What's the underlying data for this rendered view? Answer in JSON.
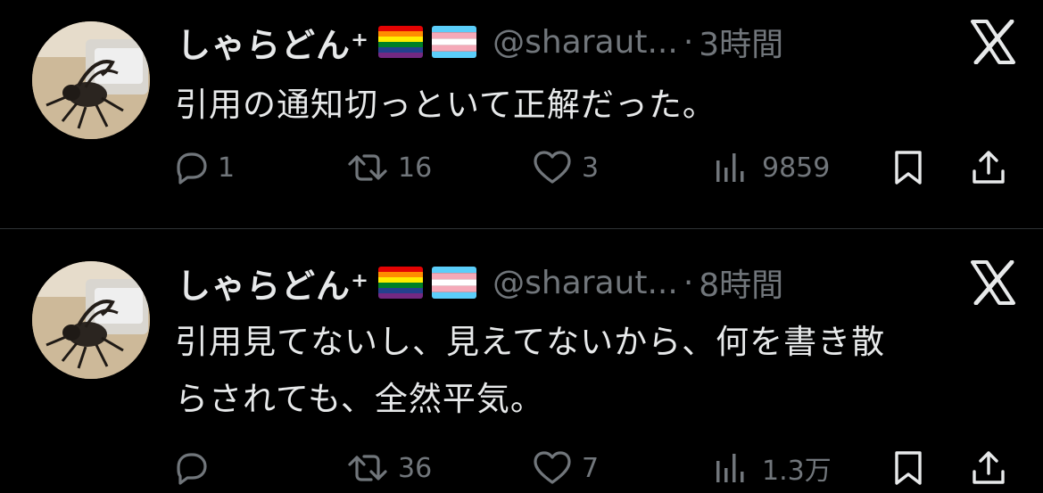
{
  "tweets": [
    {
      "display_name": "しゃらどん⁺",
      "handle": "@sharaut...",
      "separator": "·",
      "time": "3時間",
      "text_lines": [
        "引用の通知切っといて正解だった。"
      ],
      "actions": {
        "reply_count": "1",
        "retweet_count": "16",
        "like_count": "3",
        "views_count": "9859"
      }
    },
    {
      "display_name": "しゃらどん⁺",
      "handle": "@sharaut...",
      "separator": "·",
      "time": "8時間",
      "text_lines": [
        "引用見てないし、見えてないから、何を書き散",
        "らされても、全然平気。"
      ],
      "actions": {
        "reply_count": "",
        "retweet_count": "36",
        "like_count": "7",
        "views_count": "1.3万"
      }
    }
  ],
  "colors": {
    "background": "#000000",
    "primary_text": "#e7e9ea",
    "secondary_text": "#71767b",
    "divider": "#2f3336"
  },
  "icons": {
    "reply": "reply-icon",
    "retweet": "retweet-icon",
    "like": "heart-icon",
    "views": "views-icon",
    "bookmark": "bookmark-icon",
    "share": "share-icon",
    "logo": "x-logo-icon",
    "flags": [
      "rainbow-flag-icon",
      "transgender-flag-icon"
    ]
  }
}
